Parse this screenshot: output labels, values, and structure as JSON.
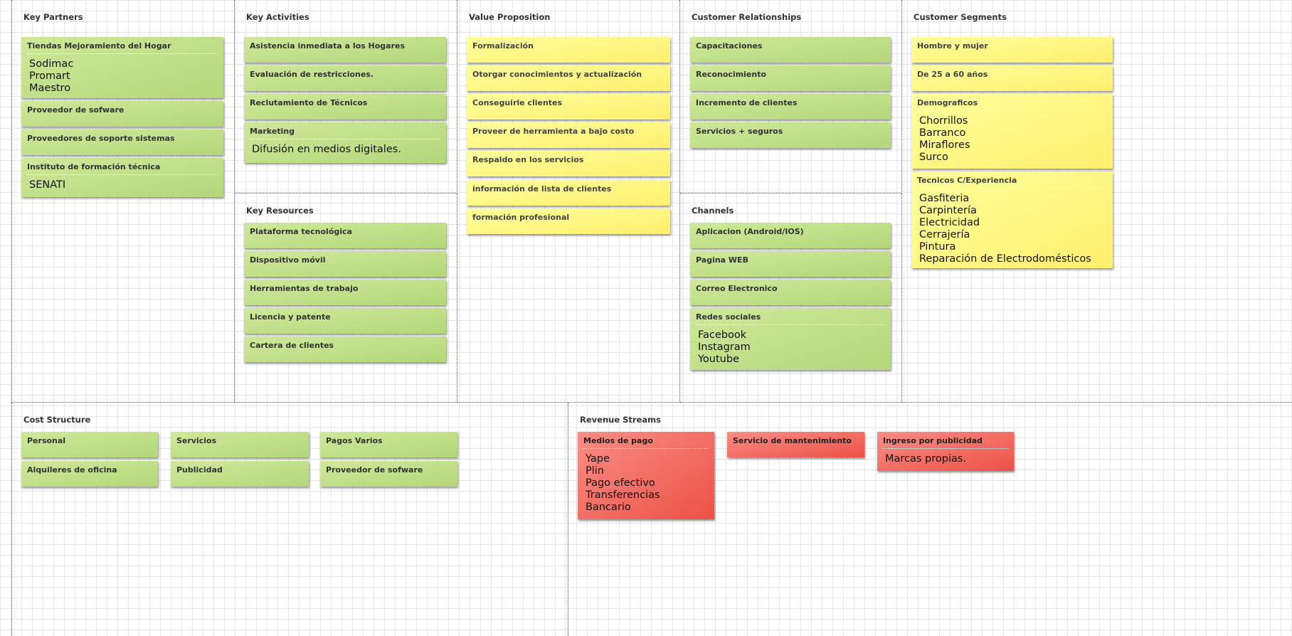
{
  "sections": {
    "key_partners": "Key Partners",
    "key_activities": "Key Activities",
    "key_resources": "Key Resources",
    "value_proposition": "Value Proposition",
    "customer_relationships": "Customer Relationships",
    "channels": "Channels",
    "customer_segments": "Customer Segments",
    "cost_structure": "Cost Structure",
    "revenue_streams": "Revenue Streams"
  },
  "key_partners": {
    "tiendas": {
      "title": "Tiendas Mejoramiento del Hogar",
      "items": [
        "Sodimac",
        "Promart",
        "Maestro"
      ]
    },
    "software": "Proveedor de sofware",
    "soporte": "Proveedores de soporte sistemas",
    "instituto": {
      "title": "Instituto de formación técnica",
      "items": [
        "SENATI"
      ]
    }
  },
  "key_activities": {
    "asistencia": "Asistencia inmediata a los Hogares",
    "evaluacion": "Evaluación de restricciones.",
    "reclutamiento": "Reclutamiento de Técnicos",
    "marketing": {
      "title": "Marketing",
      "items": [
        "Difusión en medios digitales."
      ]
    }
  },
  "key_resources": [
    "Plataforma tecnológica",
    "Dispositivo móvil",
    "Herramientas de trabajo",
    "Licencia y patente",
    "Cartera de clientes"
  ],
  "value_proposition": [
    "Formalización",
    "Otorgar conocimientos y actualización",
    "Conseguirle clientes",
    "Proveer de herramienta a bajo costo",
    "Respaldo en los servicios",
    "información de lista de clientes",
    "formación profesional"
  ],
  "customer_relationships": [
    "Capacitaciones",
    "Reconocimiento",
    "Incremento de clientes",
    "Servicios + seguros"
  ],
  "channels": {
    "app": "Aplicacion (Android/IOS)",
    "web": "Pagina WEB",
    "correo": "Correo Electronico",
    "redes": {
      "title": "Redes sociales",
      "items": [
        "Facebook",
        "Instagram",
        "Youtube"
      ]
    }
  },
  "customer_segments": {
    "genero": "Hombre y mujer",
    "edad": "De 25 a 60 años",
    "demograficos": {
      "title": "Demograficos",
      "items": [
        "Chorrillos",
        "Barranco",
        "Miraflores",
        "Surco"
      ]
    },
    "tecnicos": {
      "title": "Tecnicos C/Experiencia",
      "items": [
        "Gasfiteria",
        "Carpintería",
        "Electricidad",
        "Cerrajería",
        "Pintura",
        "Reparación de Electrodomésticos"
      ]
    }
  },
  "cost_structure": {
    "personal": "Personal",
    "alquileres": "Alquileres de oficina",
    "servicios": "Servicios",
    "publicidad": "Publicidad",
    "pagos_varios": "Pagos Varios",
    "software": "Proveedor de sofware"
  },
  "revenue_streams": {
    "medios_pago": {
      "title": "Medios de pago",
      "items": [
        "Yape",
        "Plin",
        "Pago efectivo",
        "Transferencias",
        "Bancario"
      ]
    },
    "mantenimiento": "Servicio de mantenimiento",
    "publicidad": {
      "title": "Ingreso por publicidad",
      "items": [
        "Marcas propias."
      ]
    }
  },
  "colors": {
    "green_note": "#c4e08a",
    "yellow_note": "#fff585",
    "red_note": "#f27066",
    "grid": "#e7e7e7",
    "divider": "#555555"
  }
}
